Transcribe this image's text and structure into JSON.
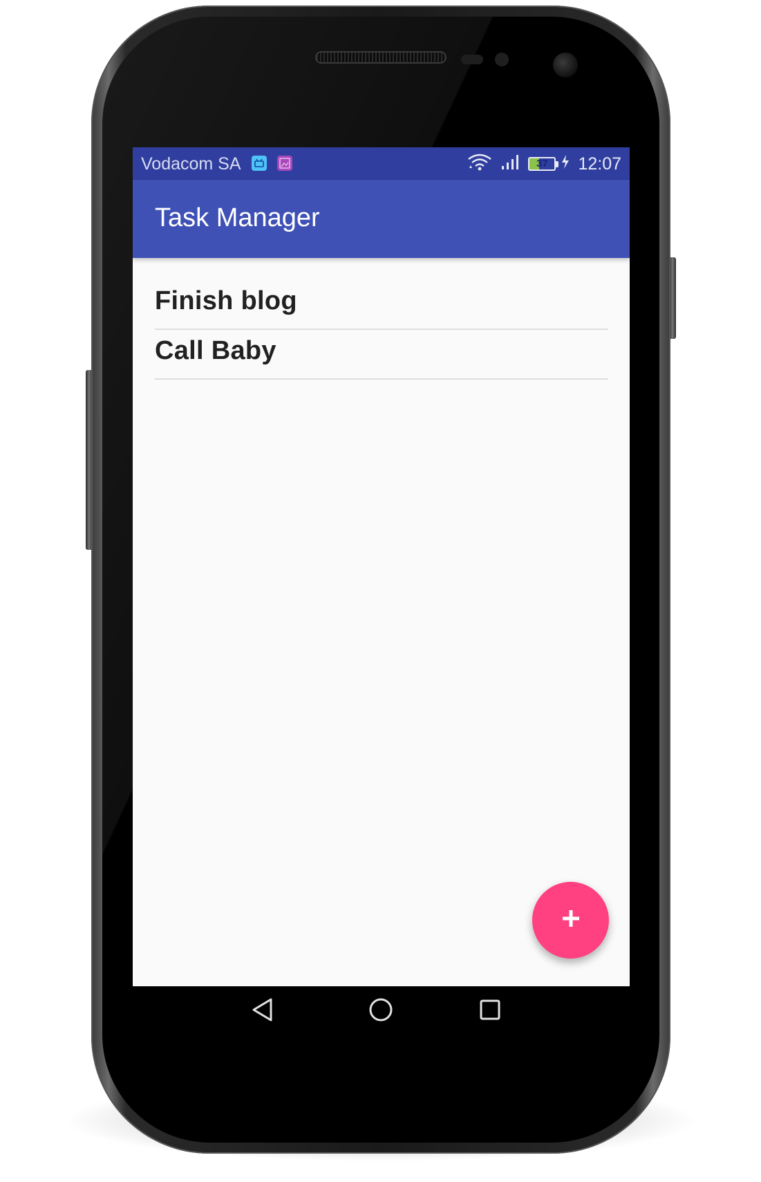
{
  "status_bar": {
    "carrier": "Vodacom SA",
    "battery_level": "37",
    "time": "12:07",
    "icons": [
      "android-notification-icon",
      "image-notification-icon",
      "wifi-icon",
      "cell-signal-icon",
      "battery-icon",
      "charging-icon"
    ]
  },
  "app_bar": {
    "title": "Task Manager"
  },
  "tasks": [
    {
      "title": "Finish blog"
    },
    {
      "title": "Call Baby"
    }
  ],
  "fab": {
    "icon": "add-icon"
  },
  "nav_bar": {
    "icons": [
      "back-icon",
      "home-icon",
      "recents-icon"
    ]
  },
  "colors": {
    "status_bar": "#303f9f",
    "app_bar": "#3f51b5",
    "accent": "#ff4081",
    "background": "#fafafa",
    "text": "#212121"
  }
}
